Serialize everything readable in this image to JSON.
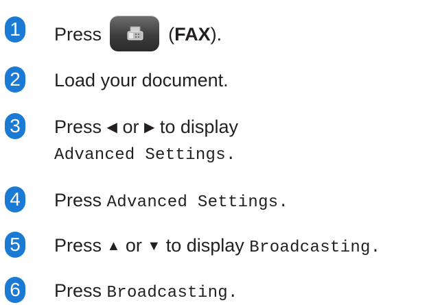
{
  "steps": [
    {
      "number": "1",
      "press": "Press",
      "open_paren": "(",
      "fax_label": "FAX",
      "close_paren": ")."
    },
    {
      "number": "2",
      "text": "Load your document."
    },
    {
      "number": "3",
      "press": "Press",
      "left_arrow": "◀",
      "or": "or",
      "right_arrow": "▶",
      "to_display": "to display",
      "setting": "Advanced Settings",
      "period": "."
    },
    {
      "number": "4",
      "press": "Press",
      "setting": "Advanced Settings",
      "period": "."
    },
    {
      "number": "5",
      "press": "Press",
      "up_arrow": "▲",
      "or": "or",
      "down_arrow": "▼",
      "to_display": "to display",
      "setting": "Broadcasting",
      "period": "."
    },
    {
      "number": "6",
      "press": "Press",
      "setting": "Broadcasting",
      "period": "."
    }
  ],
  "icons": {
    "fax_button": "fax-icon"
  },
  "colors": {
    "step_badge": "#1a7ad4",
    "text": "#231f20"
  }
}
